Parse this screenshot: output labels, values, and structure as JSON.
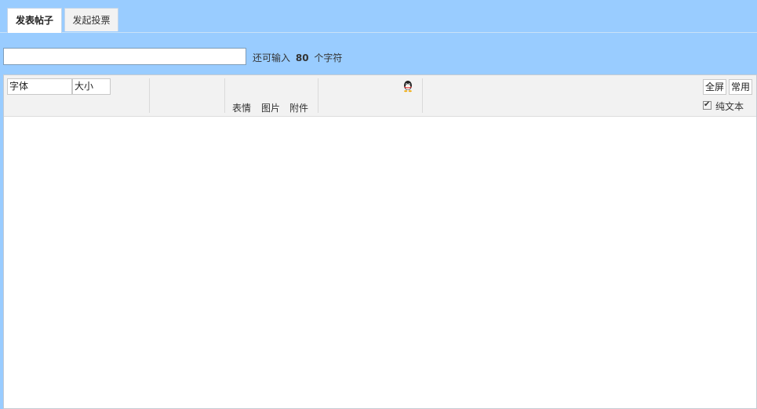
{
  "tabs": [
    {
      "label": "发表帖子",
      "active": true
    },
    {
      "label": "发起投票",
      "active": false
    }
  ],
  "title_field": {
    "value": "",
    "placeholder": ""
  },
  "char_count": {
    "prefix": "还可输入",
    "count": "80",
    "suffix": "个字符"
  },
  "toolbar": {
    "font_select": "字体",
    "size_select": "大小",
    "emoji": "表情",
    "image": "图片",
    "attachment": "附件",
    "fullscreen": "全屏",
    "common": "常用",
    "plaintext_label": "纯文本",
    "plaintext_checked": true,
    "qq_icon": "qq-penguin-icon"
  },
  "colors": {
    "page_background": "#99CCFF",
    "toolbar_background": "#F2F2F2",
    "editor_background": "#FFFFFF"
  },
  "editor": {
    "content": ""
  }
}
